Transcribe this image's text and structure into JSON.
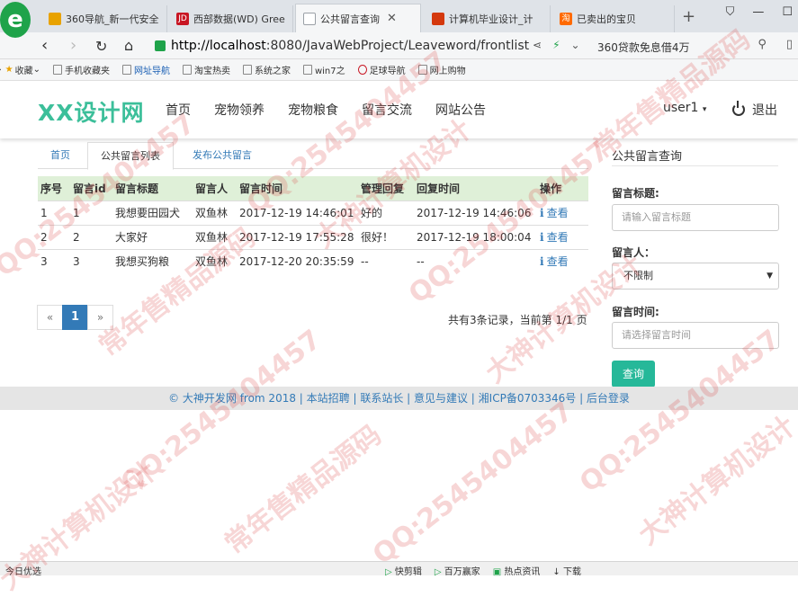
{
  "browser": {
    "tabs": [
      {
        "label": "360导航_新一代安全",
        "color": "#e8a200"
      },
      {
        "label": "西部数据(WD) Gree",
        "color": "#c81623"
      },
      {
        "label": "公共留言查询",
        "color": "#9aa0a6"
      },
      {
        "label": "计算机毕业设计_计",
        "color": "#d4380d"
      },
      {
        "label": "已卖出的宝贝",
        "color": "#ff6a00"
      }
    ],
    "new_tab_symbol": "+",
    "url_host": "http://localhost",
    "url_rest": ":8080/JavaWebProject/Leaveword/frontlist",
    "promo": "360贷款免息借4万",
    "bookmarks": [
      "收藏",
      "手机收藏夹",
      "网址导航",
      "淘宝热卖",
      "系统之家",
      "win7之",
      "足球导航",
      "网上购物"
    ]
  },
  "site": {
    "logo": "XX设计网",
    "menu": [
      "首页",
      "宠物领养",
      "宠物粮食",
      "留言交流",
      "网站公告"
    ],
    "user": "user1",
    "logout": "退出"
  },
  "subtabs": [
    "首页",
    "公共留言列表",
    "发布公共留言"
  ],
  "table": {
    "headers": [
      "序号",
      "留言id",
      "留言标题",
      "留言人",
      "留言时间",
      "管理回复",
      "回复时间",
      "操作"
    ],
    "rows": [
      [
        "1",
        "1",
        "我想要田园犬",
        "双鱼林",
        "2017-12-19 14:46:01",
        "好的",
        "2017-12-19 14:46:06",
        "查看"
      ],
      [
        "2",
        "2",
        "大家好",
        "双鱼林",
        "2017-12-19 17:55:28",
        "很好！",
        "2017-12-19 18:00:04",
        "查看"
      ],
      [
        "3",
        "3",
        "我想买狗粮",
        "双鱼林",
        "2017-12-20 20:35:59",
        "--",
        "--",
        "查看"
      ]
    ]
  },
  "pager": {
    "prev": "«",
    "current": "1",
    "next": "»",
    "info": "共有3条记录，当前第 1/1 页"
  },
  "search": {
    "title": "公共留言查询",
    "title_label": "留言标题:",
    "title_placeholder": "请输入留言标题",
    "user_label": "留言人：",
    "user_value": "不限制",
    "time_label": "留言时间:",
    "time_placeholder": "请选择留言时间",
    "button": "查询"
  },
  "footer": "© 大神开发网 from 2018 | 本站招聘 | 联系站长 | 意见与建议 | 湘ICP备0703346号 | 后台登录",
  "statusbar": {
    "left": "今日优选",
    "right": [
      "快剪辑",
      "百万赢家",
      "热点资讯",
      "下载"
    ]
  },
  "watermarks": [
    "QQ:2545404457",
    "大神计算机设计",
    "常年售精品源码"
  ]
}
